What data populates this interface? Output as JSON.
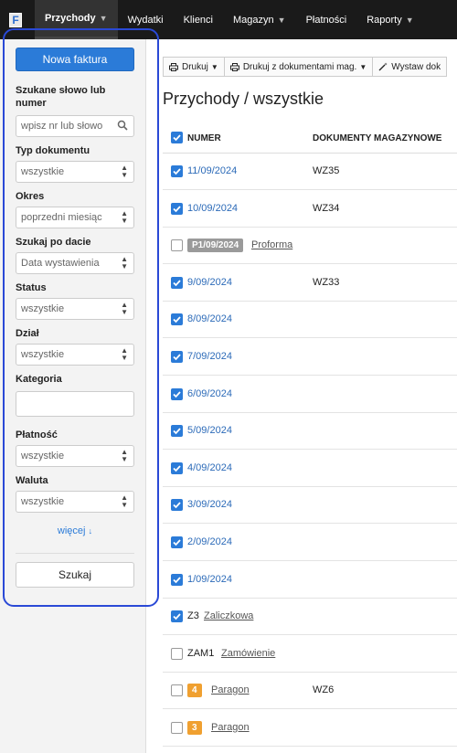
{
  "nav": {
    "logo": "F",
    "items": [
      {
        "label": "Przychody",
        "caret": true,
        "active": true
      },
      {
        "label": "Wydatki",
        "caret": false,
        "active": false
      },
      {
        "label": "Klienci",
        "caret": false,
        "active": false
      },
      {
        "label": "Magazyn",
        "caret": true,
        "active": false
      },
      {
        "label": "Płatności",
        "caret": false,
        "active": false
      },
      {
        "label": "Raporty",
        "caret": true,
        "active": false
      }
    ]
  },
  "sidebar": {
    "new_invoice": "Nowa faktura",
    "search_label": "Szukane słowo lub numer",
    "search_placeholder": "wpisz nr lub słowo",
    "doc_type_label": "Typ dokumentu",
    "doc_type_value": "wszystkie",
    "period_label": "Okres",
    "period_value": "poprzedni miesiąc",
    "date_label": "Szukaj po dacie",
    "date_value": "Data wystawienia",
    "status_label": "Status",
    "status_value": "wszystkie",
    "dept_label": "Dział",
    "dept_value": "wszystkie",
    "category_label": "Kategoria",
    "category_value": "",
    "payment_label": "Płatność",
    "payment_value": "wszystkie",
    "currency_label": "Waluta",
    "currency_value": "wszystkie",
    "more": "więcej",
    "search_button": "Szukaj"
  },
  "toolbar": {
    "print": "Drukuj",
    "print_with_docs": "Drukuj z dokumentami mag.",
    "issue": "Wystaw dok"
  },
  "page_title": "Przychody / wszystkie",
  "table": {
    "col_number": "NUMER",
    "col_docs": "DOKUMENTY MAGAZYNOWE",
    "rows": [
      {
        "number": "11/09/2024",
        "docs": "WZ35",
        "checked": true
      },
      {
        "number": "10/09/2024",
        "docs": "WZ34",
        "checked": true
      },
      {
        "badge": "P1/09/2024",
        "badge_color": "#9a9a9a",
        "link": "Proforma",
        "checked": false
      },
      {
        "number": "9/09/2024",
        "docs": "WZ33",
        "checked": true
      },
      {
        "number": "8/09/2024",
        "docs": "",
        "checked": true
      },
      {
        "number": "7/09/2024",
        "docs": "",
        "checked": true
      },
      {
        "number": "6/09/2024",
        "docs": "",
        "checked": true
      },
      {
        "number": "5/09/2024",
        "docs": "",
        "checked": true
      },
      {
        "number": "4/09/2024",
        "docs": "",
        "checked": true
      },
      {
        "number": "3/09/2024",
        "docs": "",
        "checked": true
      },
      {
        "number": "2/09/2024",
        "docs": "",
        "checked": true
      },
      {
        "number": "1/09/2024",
        "docs": "",
        "checked": true
      },
      {
        "number": "Z3",
        "link": "Zaliczkowa",
        "checked": true
      },
      {
        "number": "ZAM1",
        "link": "Zamówienie",
        "checked": false
      },
      {
        "badge": "4",
        "badge_color": "#f0a030",
        "link": "Paragon",
        "docs": "WZ6",
        "checked": false
      },
      {
        "badge": "3",
        "badge_color": "#f0a030",
        "link": "Paragon",
        "checked": false
      }
    ]
  }
}
